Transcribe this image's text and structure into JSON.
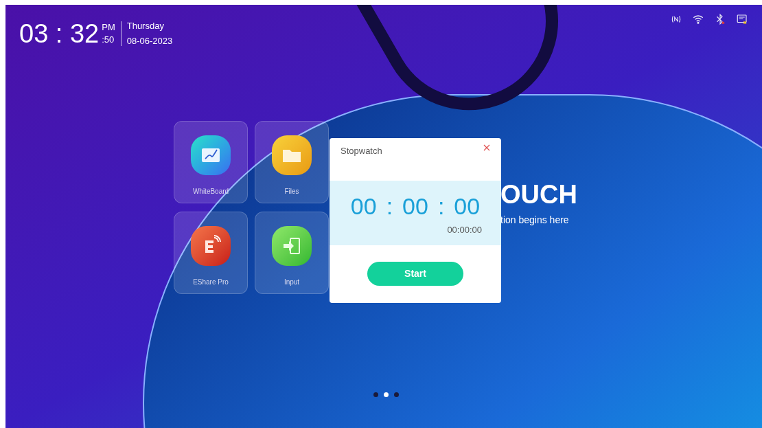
{
  "clock": {
    "time": "03 : 32",
    "period": "PM",
    "seconds": ":50",
    "weekday": "Thursday",
    "date": "08-06-2023"
  },
  "status_icons": [
    {
      "kind": "nfc"
    },
    {
      "kind": "wifi"
    },
    {
      "kind": "bluetooth_off"
    },
    {
      "kind": "cast_off"
    }
  ],
  "apps": [
    {
      "label": "WhiteBoard",
      "kind": "whiteboard"
    },
    {
      "label": "Files",
      "kind": "files"
    },
    {
      "label": "EShare Pro",
      "kind": "eshare"
    },
    {
      "label": "Input",
      "kind": "input"
    }
  ],
  "brand": {
    "title": "OUCH",
    "tagline": "tion begins here"
  },
  "stopwatch": {
    "title": "Stopwatch",
    "hours": "00",
    "minutes": "00",
    "seconds": "00",
    "separator": ":",
    "elapsed": "00:00:00",
    "button": "Start"
  },
  "pages": [
    {
      "selected": false
    },
    {
      "selected": true
    },
    {
      "selected": false
    }
  ]
}
